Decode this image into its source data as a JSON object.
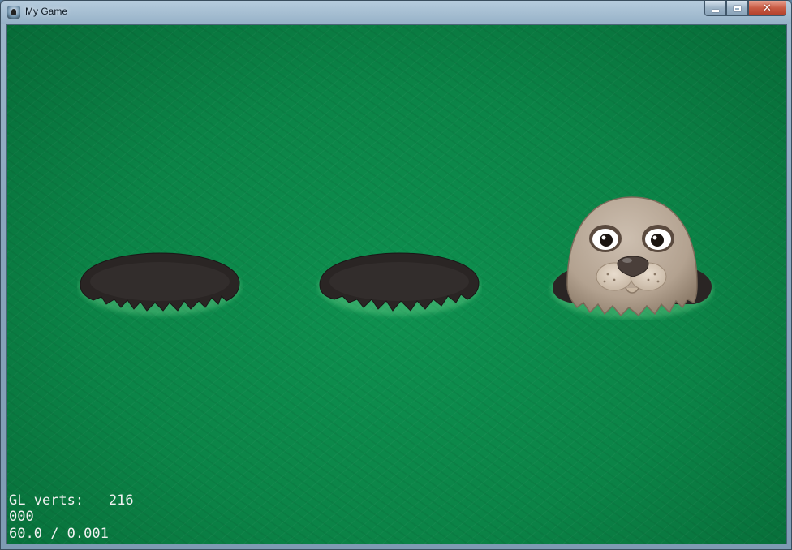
{
  "window": {
    "title": "My Game",
    "controls": {
      "minimize": "minimize",
      "maximize": "maximize",
      "close": "close"
    }
  },
  "game": {
    "holes": [
      {
        "name": "hole-1",
        "occupant": "empty"
      },
      {
        "name": "hole-2",
        "occupant": "empty"
      },
      {
        "name": "hole-3",
        "occupant": "seal"
      }
    ],
    "colors": {
      "grass": "#0b8447",
      "hole": "#2a2524",
      "seal_fur": "#b9a897",
      "seal_nose": "#4a3f3a"
    }
  },
  "hud": {
    "gl_verts_label": "GL verts:",
    "gl_verts_value": "216",
    "score": "000",
    "fps": "60.0 / 0.001"
  }
}
